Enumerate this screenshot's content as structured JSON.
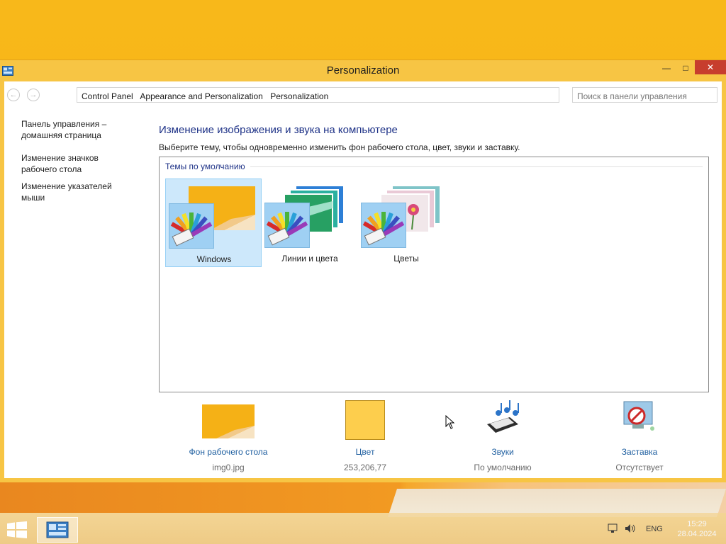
{
  "window": {
    "title": "Personalization",
    "minimize_glyph": "—",
    "maximize_glyph": "□",
    "close_glyph": "✕"
  },
  "nav": {
    "back_icon": "arrow-left-icon",
    "forward_icon": "arrow-right-icon",
    "breadcrumb": [
      "Control Panel",
      "Appearance and Personalization",
      "Personalization"
    ],
    "search_placeholder": "Поиск в панели управления"
  },
  "sidebar": {
    "links": [
      {
        "line1": "Панель управления –",
        "line2": "домашняя страница"
      },
      {
        "line1": "Изменение значков",
        "line2": "рабочего стола"
      },
      {
        "line1": "Изменение указателей",
        "line2": "мыши"
      }
    ]
  },
  "main": {
    "title": "Изменение изображения и звука на компьютере",
    "description": "Выберите тему, чтобы одновременно изменить фон рабочего стола, цвет, звуки и заставку.",
    "group_label": "Темы по умолчанию",
    "themes": [
      {
        "label": "Windows",
        "selected": true
      },
      {
        "label": "Линии и цвета",
        "selected": false
      },
      {
        "label": "Цветы",
        "selected": false
      }
    ]
  },
  "bottom": {
    "items": [
      {
        "label": "Фон рабочего стола",
        "value": "img0.jpg",
        "icon": "wallpaper-thumbnail"
      },
      {
        "label": "Цвет",
        "value": "253,206,77",
        "icon": "color-swatch"
      },
      {
        "label": "Звуки",
        "value": "По умолчанию",
        "icon": "sound-notes-icon"
      },
      {
        "label": "Заставка",
        "value": "Отсутствует",
        "icon": "screensaver-none-icon"
      }
    ]
  },
  "taskbar": {
    "lang": "ENG",
    "time": "15:29",
    "date": "28.04.2024"
  },
  "colors": {
    "accent": "#f7c544",
    "selected_color": "#fdce4d",
    "link": "#1f5fa0",
    "title_blue": "#1e3287"
  }
}
